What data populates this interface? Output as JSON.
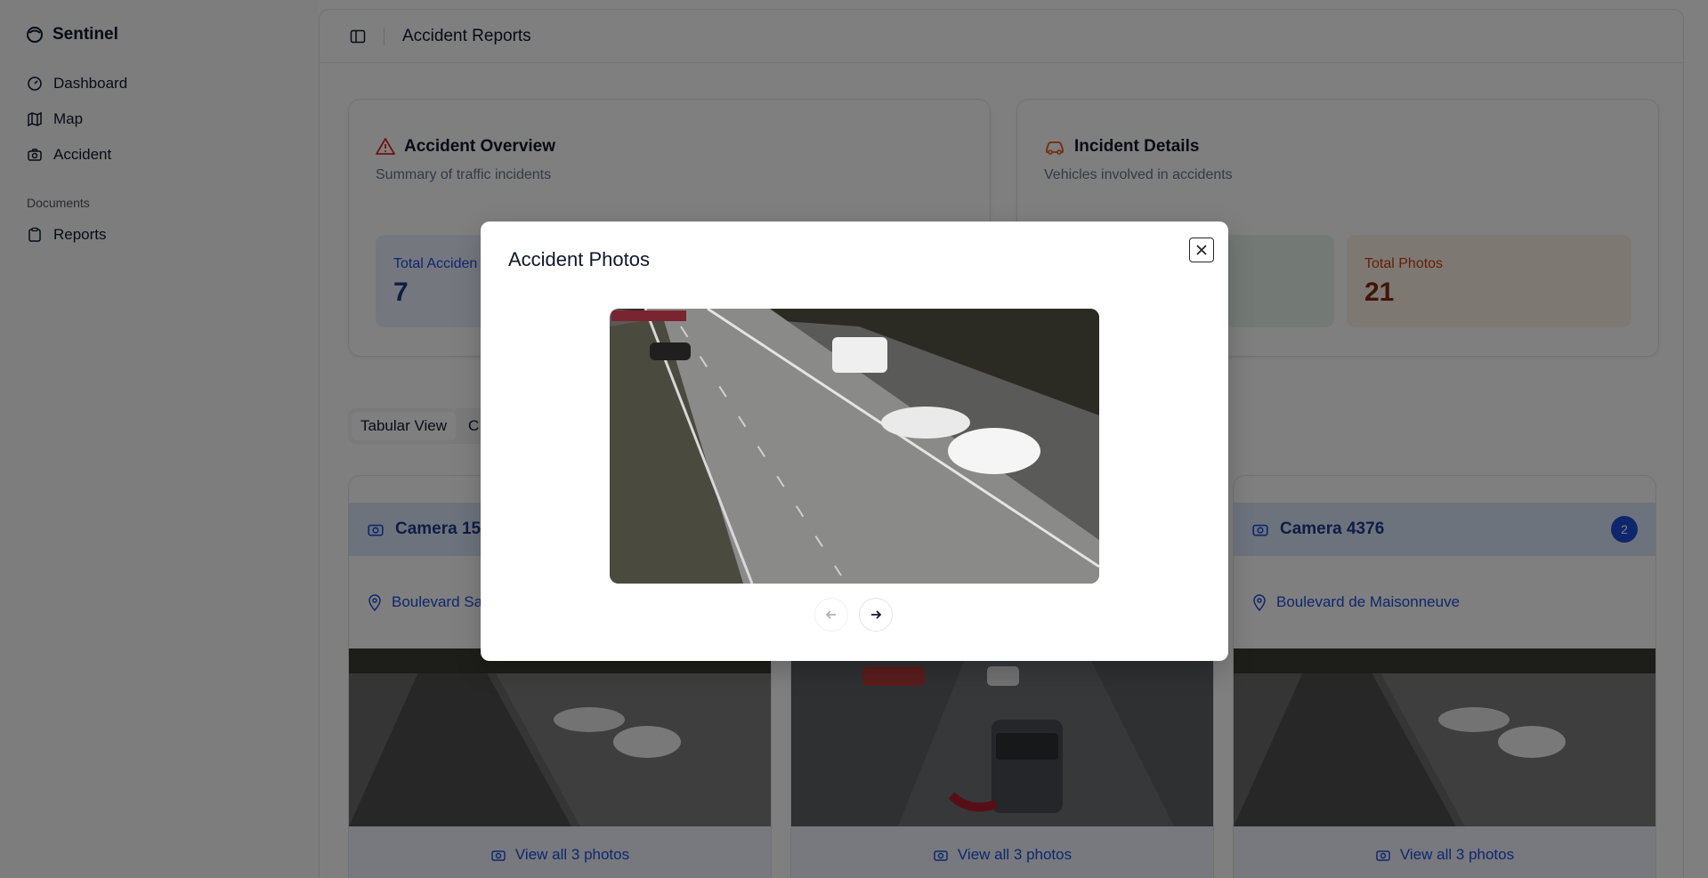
{
  "app": {
    "name": "Sentinel"
  },
  "sidebar": {
    "items": [
      {
        "label": "Dashboard",
        "icon": "gauge-icon"
      },
      {
        "label": "Map",
        "icon": "map-icon"
      },
      {
        "label": "Accident",
        "icon": "camera-icon"
      }
    ],
    "section_label": "Documents",
    "doc_items": [
      {
        "label": "Reports",
        "icon": "clipboard-icon"
      }
    ]
  },
  "header": {
    "title": "Accident Reports"
  },
  "overview": {
    "title": "Accident Overview",
    "subtitle": "Summary of traffic incidents",
    "stat_label": "Total Acciden",
    "stat_value": "7"
  },
  "incident": {
    "title": "Incident Details",
    "subtitle": "Vehicles involved in accidents",
    "stat_label": "Total Photos",
    "stat_value": "21"
  },
  "tabs": [
    {
      "label": "Tabular View"
    },
    {
      "label": "C"
    }
  ],
  "cameras": [
    {
      "name": "Camera 15",
      "location": "Boulevard Sa",
      "footer": "View all 3 photos"
    },
    {
      "name": "",
      "location": "",
      "footer": "View all 3 photos"
    },
    {
      "name": "Camera 4376",
      "location": "Boulevard de Maisonneuve",
      "footer": "View all 3 photos",
      "badge": "2"
    }
  ],
  "modal": {
    "title": "Accident Photos"
  },
  "colors": {
    "accent_blue": "#1d4ed8",
    "warning_red": "#dc2626",
    "warning_orange": "#ea580c",
    "overlay": "rgba(0,0,0,0.5)"
  }
}
